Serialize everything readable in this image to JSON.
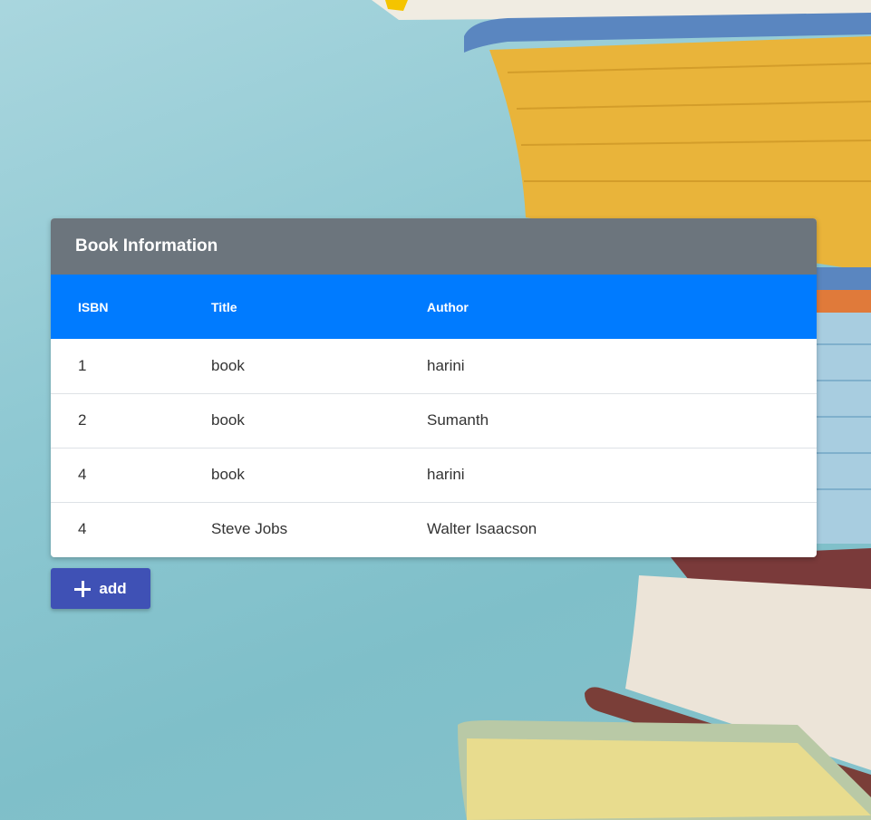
{
  "card": {
    "title": "Book Information",
    "columns": [
      "ISBN",
      "Title",
      "Author"
    ],
    "rows": [
      [
        "1",
        "book",
        "harini"
      ],
      [
        "2",
        "book",
        "Sumanth"
      ],
      [
        "4",
        "book",
        "harini"
      ],
      [
        "4",
        "Steve Jobs",
        "Walter Isaacson"
      ]
    ]
  },
  "actions": {
    "add_label": "add",
    "add_icon": "plus-icon"
  },
  "colors": {
    "header": "#6c757d",
    "table_head": "#007bff",
    "add_button": "#3f51b5"
  }
}
